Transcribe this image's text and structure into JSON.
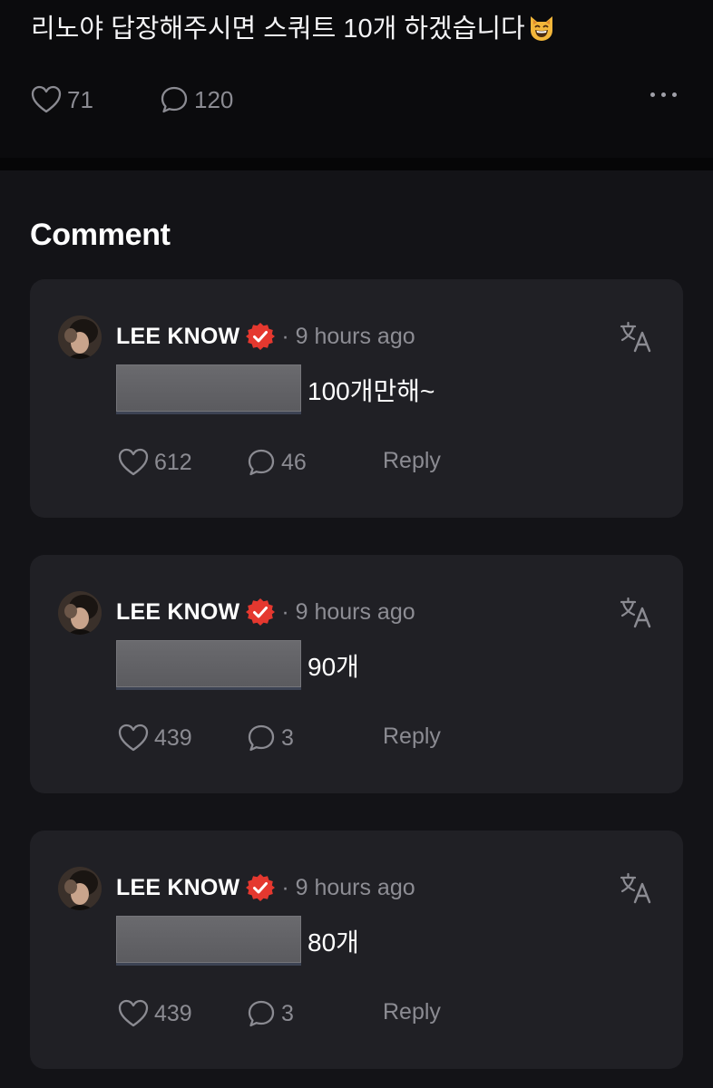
{
  "post": {
    "text": "리노야 답장해주시면 스쿼트 10개 하겠습니다",
    "emoji": "grinning-cat-emoji",
    "likes": "71",
    "comments": "120"
  },
  "section": {
    "title": "Comment"
  },
  "comments": [
    {
      "author": "LEE KNOW",
      "time": "· 9 hours ago",
      "text": "100개만해~",
      "likes": "612",
      "replies": "46",
      "reply_label": "Reply"
    },
    {
      "author": "LEE KNOW",
      "time": "· 9 hours ago",
      "text": "90개",
      "likes": "439",
      "replies": "3",
      "reply_label": "Reply"
    },
    {
      "author": "LEE KNOW",
      "time": "· 9 hours ago",
      "text": "80개",
      "likes": "439",
      "replies": "3",
      "reply_label": "Reply"
    }
  ],
  "colors": {
    "background": "#131317",
    "card": "#202025",
    "badge": "#e5382f",
    "muted": "#8b8b92"
  }
}
